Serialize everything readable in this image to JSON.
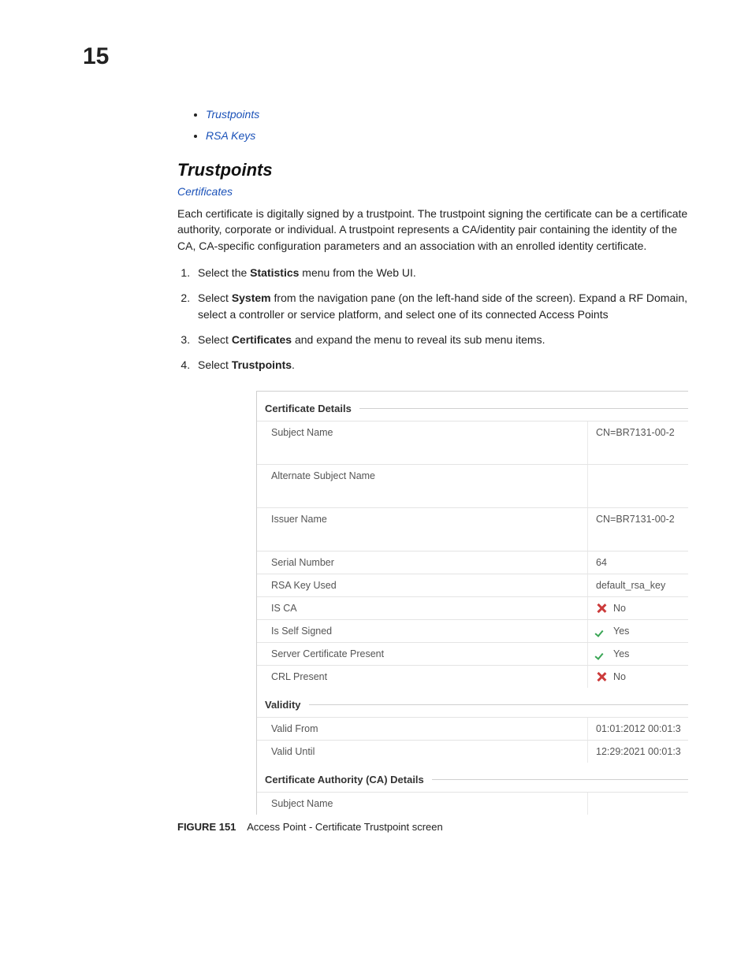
{
  "chapter": "15",
  "toc": {
    "items": [
      {
        "label": "Trustpoints"
      },
      {
        "label": "RSA Keys"
      }
    ]
  },
  "section": {
    "heading": "Trustpoints",
    "sublink": "Certificates",
    "paragraph": "Each certificate is digitally signed by a trustpoint. The trustpoint signing the certificate can be a certificate authority, corporate or individual. A trustpoint represents a CA/identity pair containing the identity of the CA, CA-specific configuration parameters and an association with an enrolled identity certificate."
  },
  "steps": [
    {
      "pre": "Select the ",
      "bold": "Statistics",
      "post": " menu from the Web UI."
    },
    {
      "pre": "Select ",
      "bold": "System",
      "post": " from the navigation pane (on the left-hand side of the screen). Expand a RF Domain, select a controller or service platform, and select one of its connected Access Points"
    },
    {
      "pre": "Select ",
      "bold": "Certificates",
      "post": " and expand the menu to reveal its sub menu items."
    },
    {
      "pre": "Select ",
      "bold": "Trustpoints",
      "post": "."
    }
  ],
  "figure": {
    "caption_label": "FIGURE 151",
    "caption_text": "Access Point - Certificate Trustpoint screen",
    "groups": [
      {
        "title": "Certificate Details",
        "rows": [
          {
            "label": "Subject Name",
            "value": "CN=BR7131-00-2",
            "height": "tall",
            "icon": null
          },
          {
            "label": "Alternate Subject Name",
            "value": "",
            "height": "tall",
            "icon": null
          },
          {
            "label": "Issuer Name",
            "value": "CN=BR7131-00-2",
            "height": "tall",
            "icon": null
          },
          {
            "label": "Serial Number",
            "value": "64",
            "height": "short",
            "icon": null
          },
          {
            "label": "RSA Key Used",
            "value": "default_rsa_key",
            "height": "short",
            "icon": null
          },
          {
            "label": "IS CA",
            "value": "No",
            "height": "short",
            "icon": "cross"
          },
          {
            "label": "Is Self Signed",
            "value": "Yes",
            "height": "short",
            "icon": "check"
          },
          {
            "label": "Server Certificate Present",
            "value": "Yes",
            "height": "short",
            "icon": "check"
          },
          {
            "label": "CRL Present",
            "value": "No",
            "height": "short",
            "icon": "cross"
          }
        ]
      },
      {
        "title": "Validity",
        "rows": [
          {
            "label": "Valid From",
            "value": "01:01:2012 00:01:3",
            "height": "short",
            "icon": null
          },
          {
            "label": "Valid Until",
            "value": "12:29:2021 00:01:3",
            "height": "short",
            "icon": null
          }
        ]
      },
      {
        "title": "Certificate Authority (CA) Details",
        "rows": [
          {
            "label": "Subject Name",
            "value": "",
            "height": "short",
            "icon": null
          }
        ]
      }
    ]
  }
}
